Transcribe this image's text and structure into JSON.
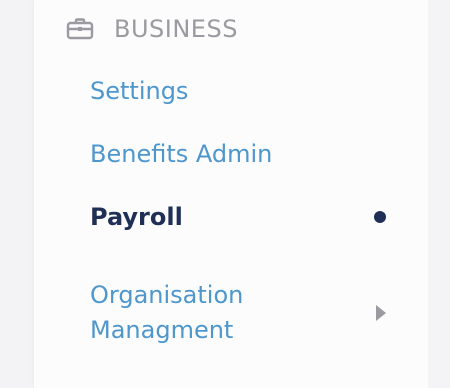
{
  "sidebar": {
    "section": {
      "icon": "briefcase-icon",
      "title": "BUSINESS"
    },
    "items": [
      {
        "label": "Settings",
        "state": "default"
      },
      {
        "label": "Benefits Admin",
        "state": "default"
      },
      {
        "label": "Payroll",
        "state": "active"
      },
      {
        "label_line1": "Organisation",
        "label_line2": "Managment",
        "state": "collapsed",
        "has_submenu": true
      }
    ],
    "colors": {
      "link": "#4e97cc",
      "active": "#1f2f55",
      "muted": "#9a9aa0"
    }
  }
}
